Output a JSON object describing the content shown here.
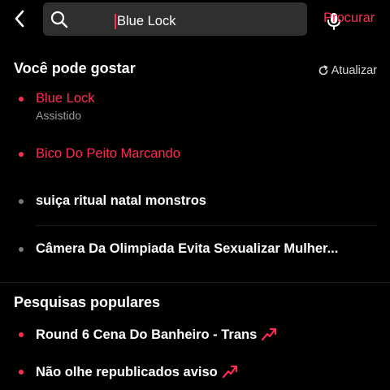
{
  "header": {
    "search_value": "Blue Lock",
    "search_placeholder": "",
    "search_action_label": "Procurar"
  },
  "suggestions": {
    "title": "Você pode gostar",
    "refresh_label": "Atualizar",
    "items": [
      {
        "label": "Blue Lock",
        "sublabel": "Assistido",
        "highlighted": true
      },
      {
        "label": "Bico Do Peito Marcando",
        "highlighted": true
      },
      {
        "label": "suiça ritual natal monstros",
        "highlighted": false
      },
      {
        "label": "Câmera Da Olimpiada Evita Sexualizar Mulher...",
        "highlighted": false
      }
    ]
  },
  "popular": {
    "title": "Pesquisas populares",
    "items": [
      {
        "label": "Round 6 Cena Do Banheiro - Trans",
        "trending": true
      },
      {
        "label": "Não olhe republicados aviso",
        "trending": true
      }
    ]
  },
  "colors": {
    "accent": "#fe2c55",
    "background": "#000000",
    "search_field": "#2f2f2f",
    "muted_dot": "#7a7a7a",
    "secondary_text": "#9a9a9a"
  },
  "icons": {
    "back": "chevron-left-icon",
    "search": "search-icon",
    "mic": "microphone-icon",
    "refresh": "refresh-icon",
    "trending": "trending-up-icon"
  }
}
